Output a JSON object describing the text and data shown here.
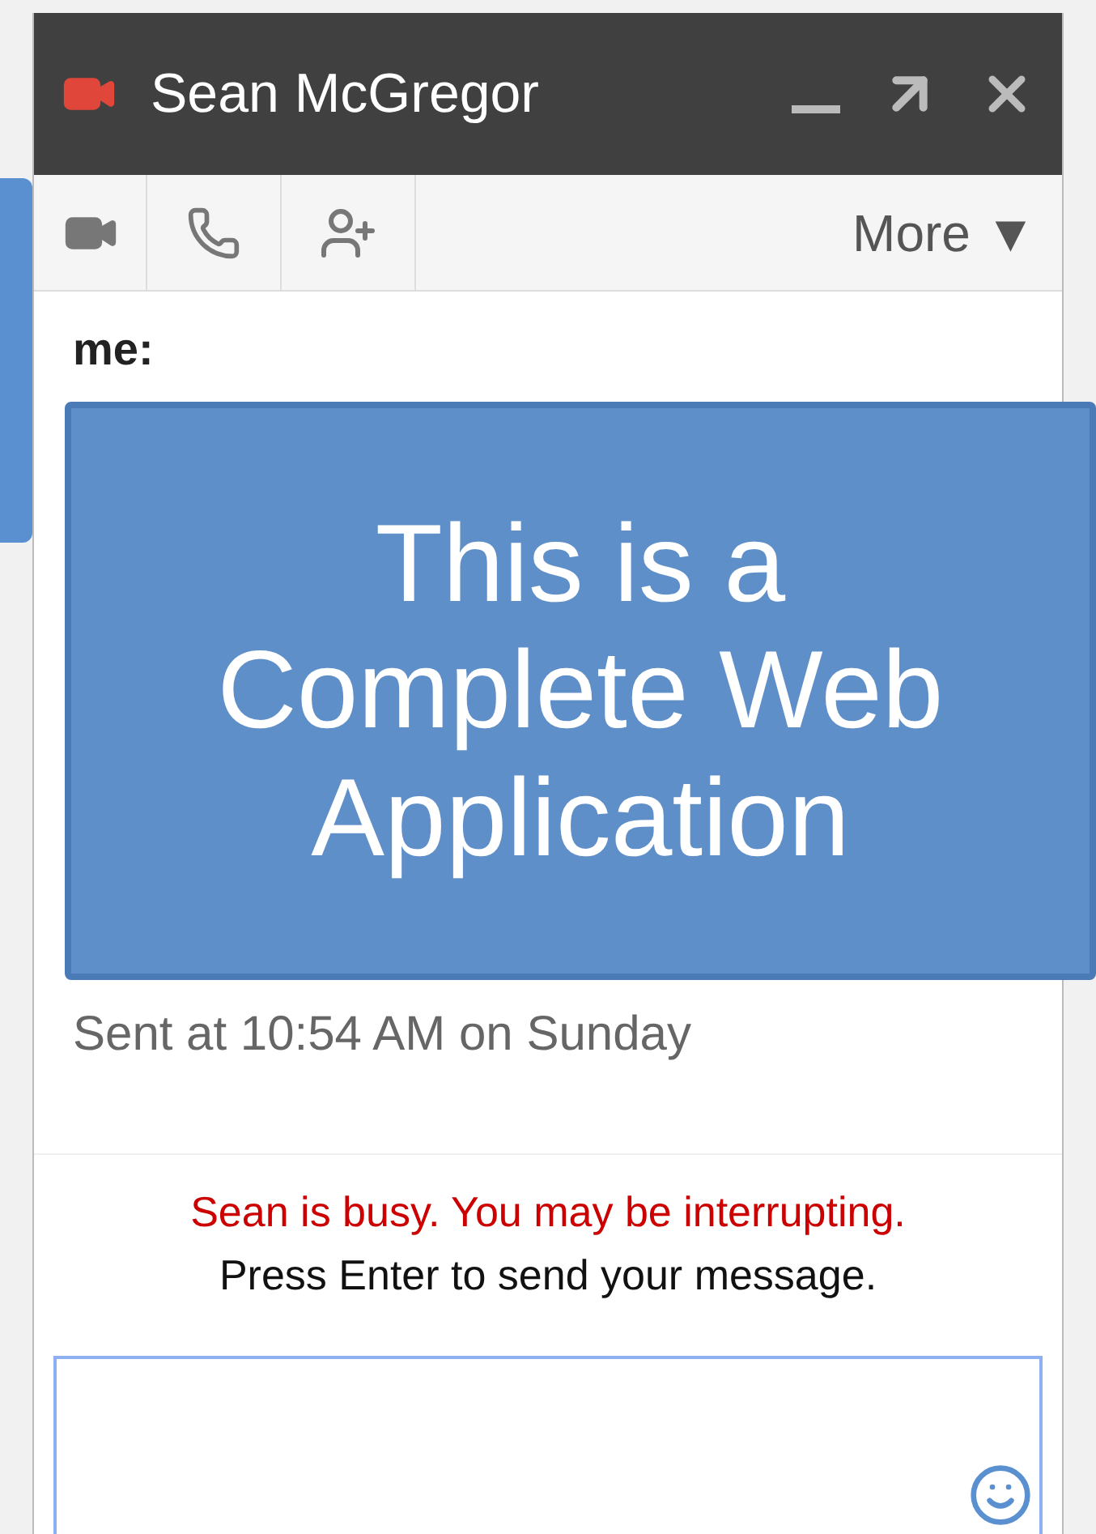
{
  "window": {
    "title": "Sean McGregor"
  },
  "toolbar": {
    "more_menu": "More ▼"
  },
  "messages": [
    {
      "sender": "me:",
      "sent": "Sent at 10:54 AM on Sunday"
    }
  ],
  "status": {
    "busy_notice": "Sean is busy. You may be interrupting.",
    "hint": "Press Enter to send your message."
  },
  "callout": {
    "text": "This is a Complete Web Application"
  }
}
